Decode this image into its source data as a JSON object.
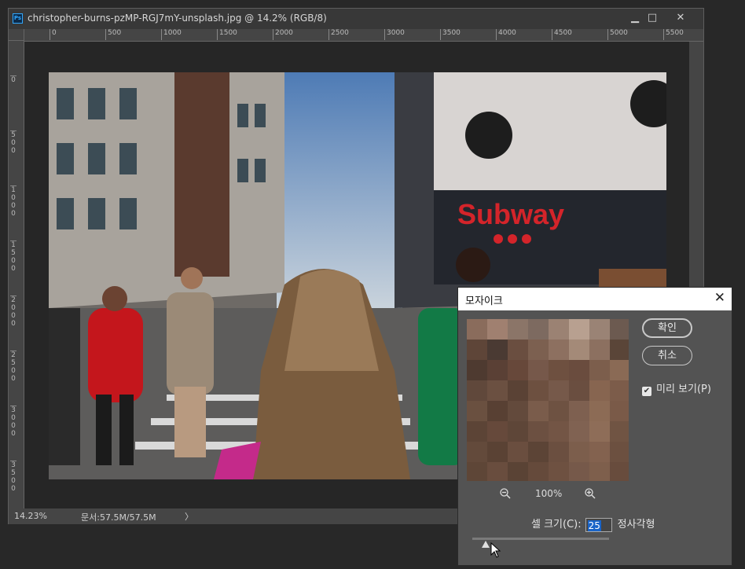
{
  "document": {
    "title": "christopher-burns-pzMP-RGJ7mY-unsplash.jpg @ 14.2% (RGB/8)",
    "app_icon": "Ps",
    "window_controls": {
      "minimize": "▁",
      "maximize": "□",
      "close": "✕"
    },
    "ruler_h_labels": [
      "0",
      "500",
      "1000",
      "1500",
      "2000",
      "2500",
      "3000",
      "3500",
      "4000",
      "4500",
      "5000",
      "5500"
    ],
    "ruler_v_labels": [
      "0",
      "500",
      "1000",
      "1500",
      "2000",
      "2500",
      "3000",
      "3500"
    ],
    "photo_sign_text": "Subway",
    "status": {
      "zoom": "14.23%",
      "doc_size": "문서:57.5M/57.5M",
      "arrow": "〉"
    }
  },
  "dialog": {
    "title": "모자이크",
    "close_label": "✕",
    "ok_label": "확인",
    "cancel_label": "취소",
    "preview_checked": true,
    "preview_label": "미리 보기(P)",
    "zoom_level": "100%",
    "cell_size_label": "셀 크기(C):",
    "cell_size_value": "25",
    "unit_label": "정사각형",
    "slider_fraction": 0.1
  },
  "mosaic_colors": [
    [
      "#8a6c5c",
      "#a08070",
      "#8b7568",
      "#7d6a60",
      "#9b8273",
      "#b8a090",
      "#9a8375",
      "#6c5a50"
    ],
    [
      "#5e4538",
      "#4a3a33",
      "#6a4e40",
      "#7c6050",
      "#8d7060",
      "#a48a78",
      "#8c7060",
      "#5a4538"
    ],
    [
      "#4e3a30",
      "#5a4035",
      "#67483a",
      "#76584a",
      "#6e5040",
      "#6a4c3e",
      "#7c5e4c",
      "#8a6a55"
    ],
    [
      "#60483b",
      "#6b5041",
      "#5a4235",
      "#6d5040",
      "#76594a",
      "#6a4e40",
      "#876550",
      "#7c5c4a"
    ],
    [
      "#6a5040",
      "#584033",
      "#634a3c",
      "#7a5c4b",
      "#6e5242",
      "#7e6050",
      "#8c6b55",
      "#7a5a48"
    ],
    [
      "#5c4436",
      "#66493b",
      "#5e4638",
      "#6c5041",
      "#735545",
      "#806252",
      "#8e6d58",
      "#705443"
    ],
    [
      "#634a3b",
      "#5a4234",
      "#6a4e3f",
      "#5c4436",
      "#6b4f40",
      "#7c5e4c",
      "#83624f",
      "#6c5040"
    ],
    [
      "#5e4637",
      "#694d3e",
      "#5a4335",
      "#654a3b",
      "#6e5141",
      "#76594a",
      "#7e5f4c",
      "#684c3d"
    ]
  ]
}
